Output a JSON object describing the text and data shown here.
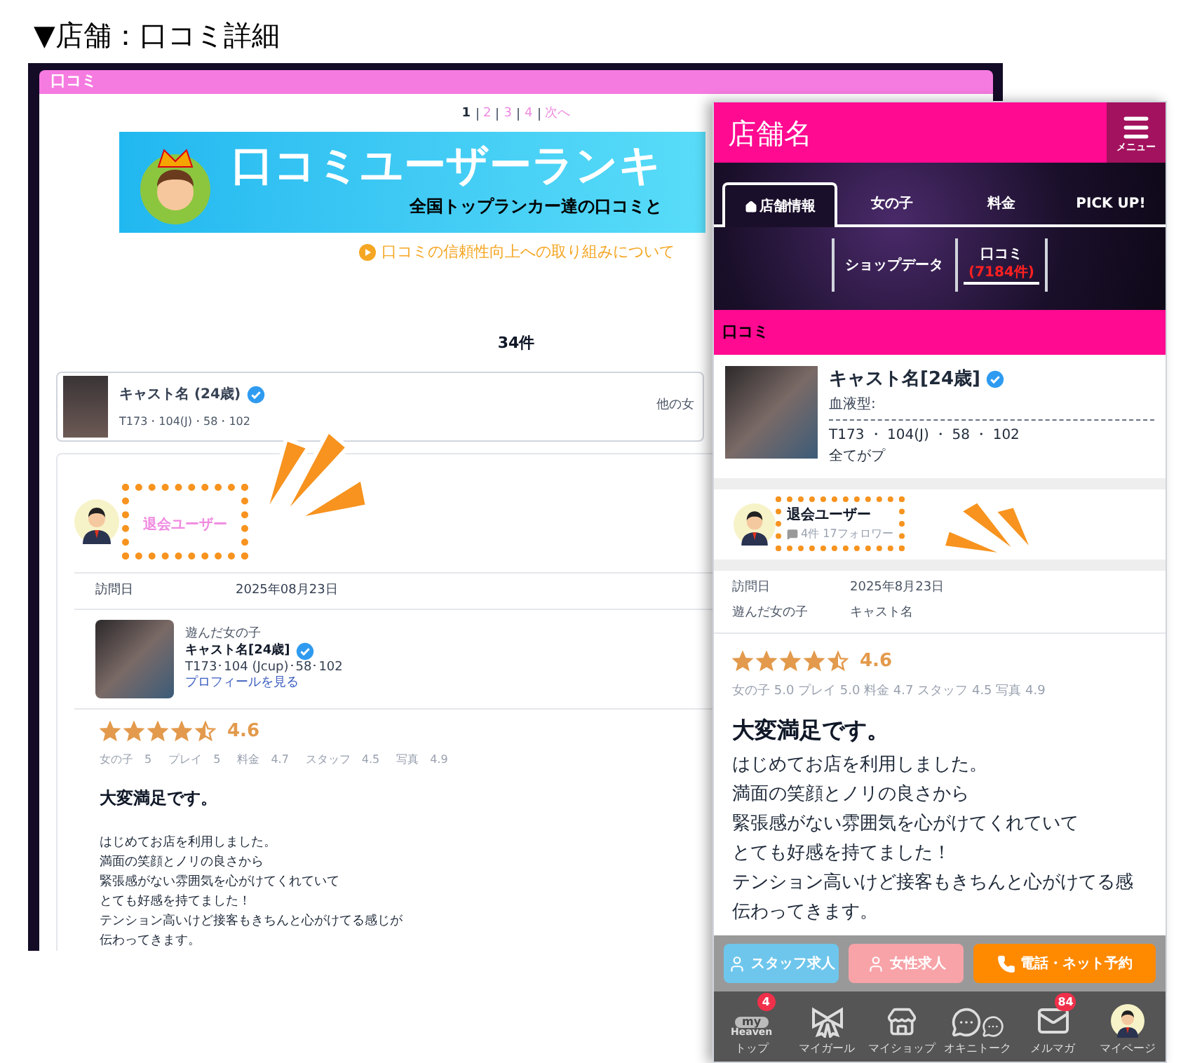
{
  "heading": "▼店舗：口コミ詳細",
  "desktop": {
    "header": "口コミ",
    "pagination": [
      {
        "label": "1",
        "selected": true
      },
      {
        "label": "2",
        "selected": false
      },
      {
        "label": "3",
        "selected": false
      },
      {
        "label": "4",
        "selected": false
      },
      {
        "label": "次へ",
        "selected": false
      }
    ],
    "banner": {
      "title": "口コミユーザーランキ",
      "subtitle": "全国トップランカー達の口コミと"
    },
    "notice_link": "口コミの信頼性向上への取り組みについて",
    "count": "34件",
    "cast_card": {
      "name": "キャスト名 (24歳)",
      "verified": true,
      "specs": "T173・104(J)・58・102",
      "column_2": "他の女"
    },
    "review": {
      "user": "退会ユーザー",
      "details": [
        {
          "label": "訪問日",
          "value": "2025年08月23日"
        }
      ],
      "girl": {
        "label": "遊んだ女の子",
        "name": "キャスト名[24歳]",
        "verified": true,
        "specs": "T173･104 (Jcup)･58･102",
        "link": "プロフィールを見る"
      },
      "stars": 4.5,
      "score": "4.6",
      "sub_scores": [
        {
          "label": "女の子",
          "value": "5"
        },
        {
          "label": "プレイ",
          "value": "5"
        },
        {
          "label": "料金",
          "value": "4.7"
        },
        {
          "label": "スタッフ",
          "value": "4.5"
        },
        {
          "label": "写真",
          "value": "4.9"
        }
      ],
      "title": "大変満足です。",
      "body": [
        "はじめてお店を利用しました。",
        "満面の笑顔とノリの良さから",
        "緊張感がない雰囲気を心がけてくれていて",
        "とても好感を持てました！",
        "テンション高いけど接客もきちんと心がけてる感じが",
        "伝わってきます。"
      ]
    }
  },
  "mobile": {
    "shop_name": "店舗名",
    "menu_label": "メニュー",
    "tabs": [
      {
        "label": "店舗情報",
        "selected": true
      },
      {
        "label": "女の子",
        "selected": false
      },
      {
        "label": "料金",
        "selected": false
      },
      {
        "label": "PICK UP!",
        "selected": false
      }
    ],
    "subtabs": [
      {
        "label": "ショップデータ",
        "selected": false
      },
      {
        "label": "口コミ",
        "count": "(7184件)",
        "selected": true
      }
    ],
    "section": "口コミ",
    "cast": {
      "name": "キャスト名[24歳]",
      "verified": true,
      "blood": "血液型:",
      "specs": "T173 ・ 104(J) ・ 58 ・ 102",
      "comment": "全てがプ"
    },
    "review": {
      "user": "退会ユーザー",
      "stats": "4件 17フォロワー",
      "details": [
        {
          "label": "訪問日",
          "value": "2025年8月23日"
        },
        {
          "label": "遊んだ女の子",
          "value": "キャスト名"
        }
      ],
      "stars": 4.5,
      "score": "4.6",
      "sub_scores": "女の子 5.0 プレイ 5.0 料金 4.7 スタッフ 4.5 写真 4.9",
      "title": "大変満足です。",
      "body": [
        "はじめてお店を利用しました。",
        "満面の笑顔とノリの良さから",
        "緊張感がない雰囲気を心がけてくれていて",
        "とても好感を持てました！",
        "テンション高いけど接客もきちんと心がけてる感",
        "伝わってきます。"
      ]
    },
    "actions": [
      {
        "label": "スタッフ求人",
        "kind": "person",
        "color": "#6ec6ec"
      },
      {
        "label": "女性求人",
        "kind": "person",
        "color": "#f7a3a8"
      },
      {
        "label": "電話・ネット予約",
        "kind": "phone",
        "color": "#ff8a00"
      }
    ],
    "nav": [
      {
        "label": "トップ",
        "kind": "logo",
        "logo_top": "my",
        "logo_bottom": "Heaven",
        "badge": "4"
      },
      {
        "label": "マイガール",
        "kind": "bow"
      },
      {
        "label": "マイショップ",
        "kind": "shop"
      },
      {
        "label": "オキニトーク",
        "kind": "chat"
      },
      {
        "label": "メルマガ",
        "kind": "mail",
        "badge": "84"
      },
      {
        "label": "マイページ",
        "kind": "avatar"
      }
    ]
  }
}
